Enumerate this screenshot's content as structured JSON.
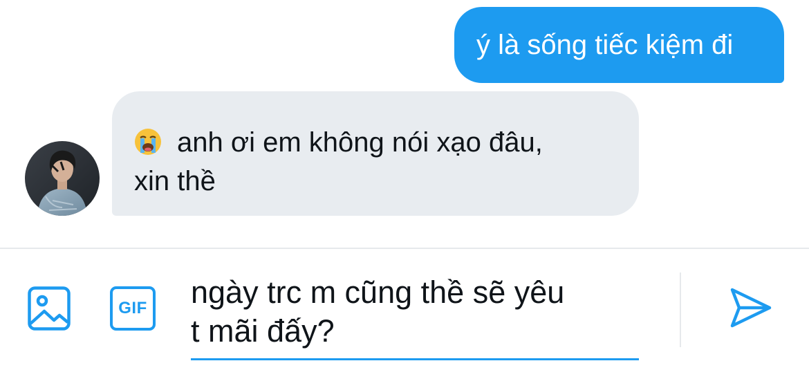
{
  "theme": {
    "accent": "#1d9bf0",
    "incoming_bubble": "#e8ecf0"
  },
  "messages": [
    {
      "direction": "outgoing",
      "text": "ý là sống tiếc kiệm đi"
    },
    {
      "direction": "incoming",
      "emoji": "loudly-crying-face-emoji",
      "line1": "anh ơi em không nói xạo đâu,",
      "line2": "xin thề"
    }
  ],
  "composer": {
    "image_icon": "image-icon",
    "gif_label": "GIF",
    "draft_line1": "ngày trc m cũng thề sẽ yêu",
    "draft_line2": "t mãi đấy?",
    "send_icon": "send-icon"
  }
}
